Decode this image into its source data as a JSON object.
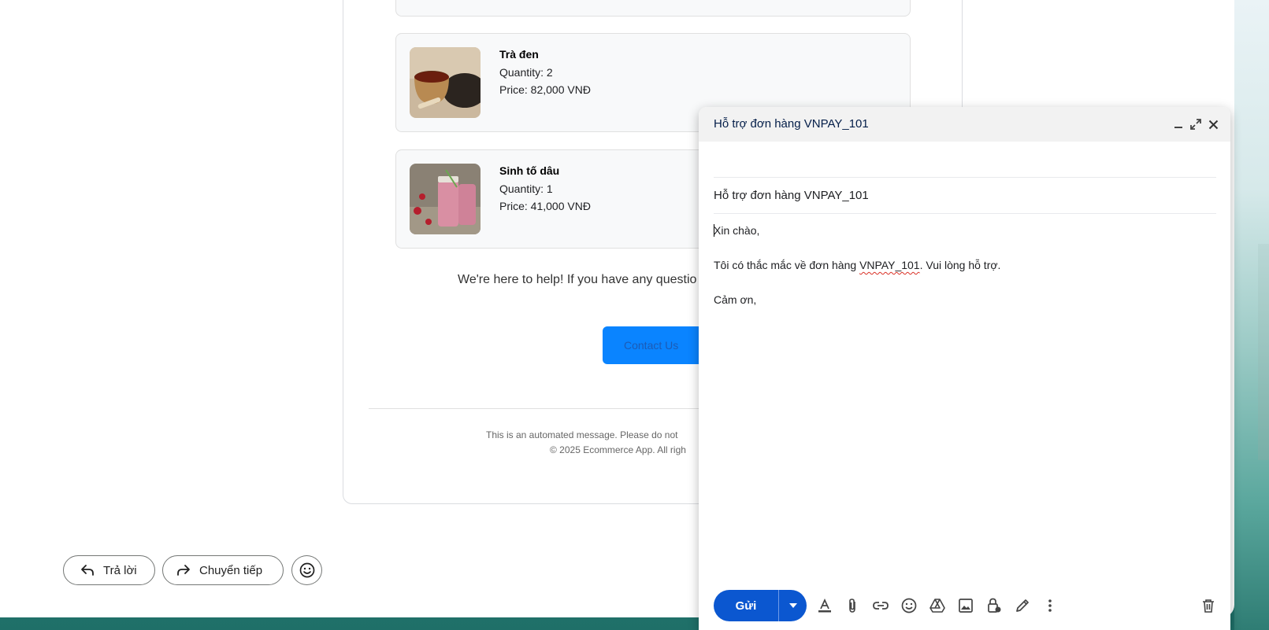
{
  "items": [
    {
      "name": "Trà đen",
      "quantity": "Quantity: 2",
      "price": "Price: 82,000 VNĐ",
      "image": "black-tea-photo"
    },
    {
      "name": "Sinh tố dâu",
      "quantity": "Quantity: 1",
      "price": "Price: 41,000 VNĐ",
      "image": "strawberry-smoothie-photo"
    }
  ],
  "email": {
    "help_text": "We're here to help! If you have any questio",
    "contact_label": "Contact Us",
    "footer_line1": "This is an automated message. Please do not",
    "footer_line2": "© 2025 Ecommerce App. All righ"
  },
  "actions": {
    "reply_label": "Trả lời",
    "forward_label": "Chuyển tiếp",
    "reply_icon": "reply-arrow-icon",
    "forward_icon": "forward-arrow-icon",
    "emoji_icon": "smiley-icon"
  },
  "compose": {
    "title": "Hỗ trợ đơn hàng VNPAY_101",
    "subject": "Hỗ trợ đơn hàng VNPAY_101",
    "body_greeting": "Xin chào,",
    "body_line_before": "Tôi có thắc mắc về đơn hàng ",
    "body_order_id": "VNPAY_101",
    "body_line_after": ". Vui lòng hỗ trợ.",
    "body_closing": "Cảm ơn,",
    "send_label": "Gửi",
    "header_icons": [
      "minimize-icon",
      "expand-icon",
      "close-icon"
    ],
    "toolbar_icons": [
      "text-format-icon",
      "attach-icon",
      "link-icon",
      "emoji-icon",
      "drive-icon",
      "photo-icon",
      "confidential-lock-icon",
      "signature-pen-icon",
      "more-options-icon",
      "trash-icon"
    ]
  },
  "colors": {
    "send_button": "#0b57d0",
    "contact_button": "#0a84ff",
    "compose_header": "#f2f2f2"
  }
}
